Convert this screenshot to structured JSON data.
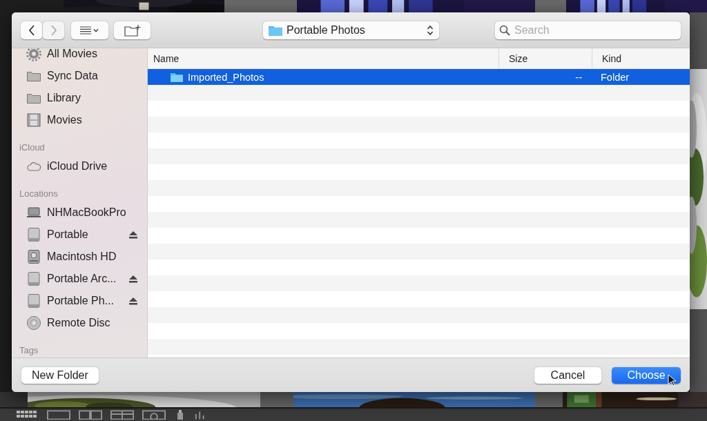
{
  "dialog": {
    "toolbar": {
      "nav_buttons": [
        {
          "kind": "back",
          "disabled": false
        },
        {
          "kind": "forward",
          "disabled": true
        }
      ],
      "location": "Portable Photos",
      "search": {
        "placeholder": "Search"
      }
    },
    "sidebar": {
      "sections": [
        {
          "items": [
            {
              "label": "All Movies",
              "kind": "gear",
              "ejectable": false
            },
            {
              "label": "Sync Data",
              "kind": "folder",
              "ejectable": false
            },
            {
              "label": "Library",
              "kind": "folder",
              "ejectable": false
            },
            {
              "label": "Movies",
              "kind": "film",
              "ejectable": false
            }
          ]
        },
        {
          "title": "iCloud",
          "items": [
            {
              "label": "iCloud Drive",
              "kind": "cloud",
              "ejectable": false
            }
          ]
        },
        {
          "title": "Locations",
          "items": [
            {
              "label": "NHMacBookPro",
              "kind": "laptop",
              "ejectable": false
            },
            {
              "label": "Portable",
              "kind": "drive",
              "ejectable": true
            },
            {
              "label": "Macintosh HD",
              "kind": "internal-drive",
              "ejectable": false
            },
            {
              "label": "Portable Arc...",
              "kind": "drive",
              "ejectable": true
            },
            {
              "label": "Portable Ph...",
              "kind": "drive",
              "ejectable": true
            },
            {
              "label": "Remote Disc",
              "kind": "disc",
              "ejectable": false
            }
          ]
        },
        {
          "title": "Tags"
        }
      ]
    },
    "file_list": {
      "columns": [
        "Name",
        "Size",
        "Kind"
      ],
      "rows": [
        {
          "cells": [
            "Imported_Photos",
            "--",
            "Folder"
          ],
          "selected": true
        }
      ]
    },
    "footer": {
      "new_folder": "New Folder",
      "buttons": [
        {
          "label": "Cancel",
          "default": false
        },
        {
          "label": "Choose",
          "default": true
        }
      ]
    }
  }
}
